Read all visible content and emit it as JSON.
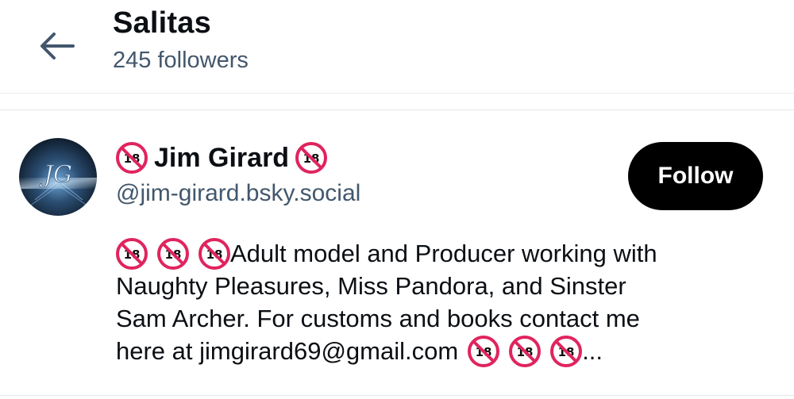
{
  "header": {
    "title": "Salitas",
    "subtitle": "245 followers"
  },
  "user": {
    "avatar_text": "JG",
    "name": "Jim Girard",
    "handle": "@jim-girard.bsky.social",
    "follow_label": "Follow",
    "bio_line1": "Adult model and Producer working with",
    "bio_line2": "Naughty Pleasures, Miss Pandora, and Sinster",
    "bio_line3": "Sam Archer.  For customs and books contact me",
    "bio_line4": "here at jimgirard69@gmail.com",
    "bio_ellipsis": "...",
    "badge_text": "18"
  },
  "colors": {
    "accent_text": "#42576c",
    "follow_bg": "#000000",
    "no18_red": "#e0245e"
  },
  "icons": [
    "back-arrow-icon",
    "no-under-18-icon"
  ]
}
